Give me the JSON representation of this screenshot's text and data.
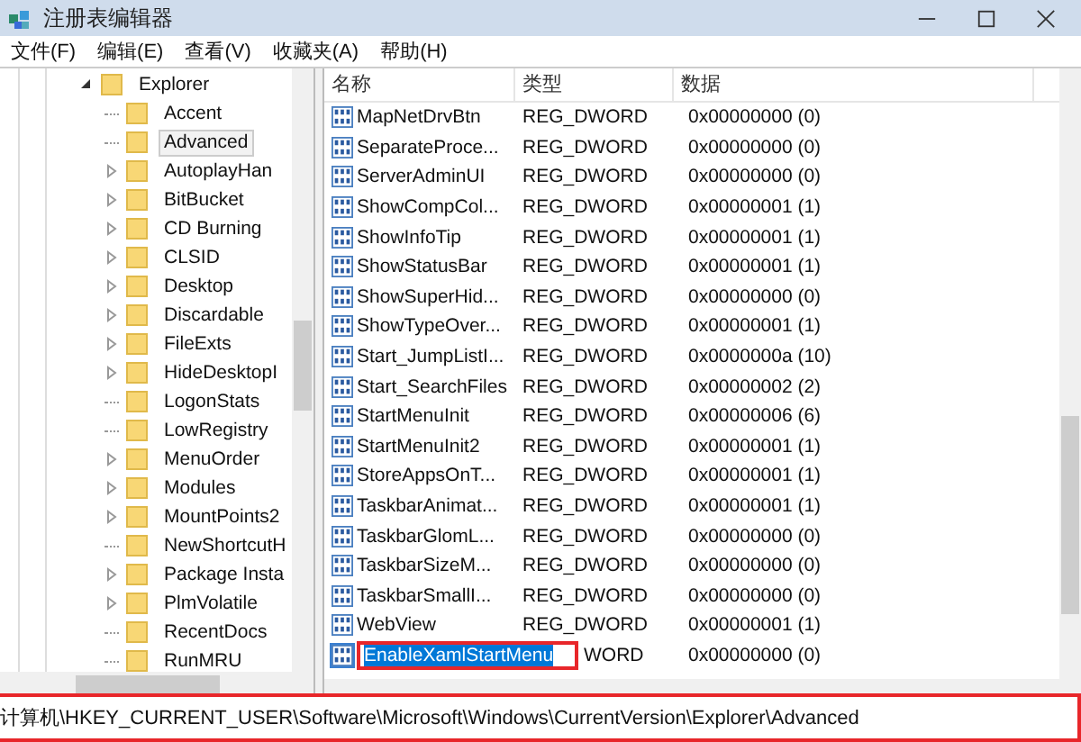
{
  "window": {
    "title": "注册表编辑器"
  },
  "menu": [
    "文件(F)",
    "编辑(E)",
    "查看(V)",
    "收藏夹(A)",
    "帮助(H)"
  ],
  "tree": {
    "label": "Explorer",
    "expanded": true,
    "children": [
      {
        "label": "Accent",
        "expandable": false,
        "selected": false
      },
      {
        "label": "Advanced",
        "expandable": false,
        "selected": true
      },
      {
        "label": "AutoplayHan",
        "expandable": true,
        "selected": false
      },
      {
        "label": "BitBucket",
        "expandable": true,
        "selected": false
      },
      {
        "label": "CD Burning",
        "expandable": true,
        "selected": false
      },
      {
        "label": "CLSID",
        "expandable": true,
        "selected": false
      },
      {
        "label": "Desktop",
        "expandable": true,
        "selected": false
      },
      {
        "label": "Discardable",
        "expandable": true,
        "selected": false
      },
      {
        "label": "FileExts",
        "expandable": true,
        "selected": false
      },
      {
        "label": "HideDesktopI",
        "expandable": true,
        "selected": false
      },
      {
        "label": "LogonStats",
        "expandable": false,
        "selected": false
      },
      {
        "label": "LowRegistry",
        "expandable": false,
        "selected": false
      },
      {
        "label": "MenuOrder",
        "expandable": true,
        "selected": false
      },
      {
        "label": "Modules",
        "expandable": true,
        "selected": false
      },
      {
        "label": "MountPoints2",
        "expandable": true,
        "selected": false
      },
      {
        "label": "NewShortcutH",
        "expandable": false,
        "selected": false
      },
      {
        "label": "Package Insta",
        "expandable": true,
        "selected": false
      },
      {
        "label": "PlmVolatile",
        "expandable": true,
        "selected": false
      },
      {
        "label": "RecentDocs",
        "expandable": false,
        "selected": false
      },
      {
        "label": "RunMRU",
        "expandable": false,
        "selected": false
      }
    ]
  },
  "table": {
    "columns": [
      "名称",
      "类型",
      "数据"
    ],
    "rows": [
      {
        "kind": "value",
        "name": "MapNetDrvBtn",
        "type": "REG_DWORD",
        "data": "0x00000000 (0)"
      },
      {
        "kind": "value",
        "name": "SeparateProce...",
        "type": "REG_DWORD",
        "data": "0x00000000 (0)"
      },
      {
        "kind": "value",
        "name": "ServerAdminUI",
        "type": "REG_DWORD",
        "data": "0x00000000 (0)"
      },
      {
        "kind": "value",
        "name": "ShowCompCol...",
        "type": "REG_DWORD",
        "data": "0x00000001 (1)"
      },
      {
        "kind": "value",
        "name": "ShowInfoTip",
        "type": "REG_DWORD",
        "data": "0x00000001 (1)"
      },
      {
        "kind": "value",
        "name": "ShowStatusBar",
        "type": "REG_DWORD",
        "data": "0x00000001 (1)"
      },
      {
        "kind": "value",
        "name": "ShowSuperHid...",
        "type": "REG_DWORD",
        "data": "0x00000000 (0)"
      },
      {
        "kind": "value",
        "name": "ShowTypeOver...",
        "type": "REG_DWORD",
        "data": "0x00000001 (1)"
      },
      {
        "kind": "value",
        "name": "Start_JumpListI...",
        "type": "REG_DWORD",
        "data": "0x0000000a (10)"
      },
      {
        "kind": "value",
        "name": "Start_SearchFiles",
        "type": "REG_DWORD",
        "data": "0x00000002 (2)"
      },
      {
        "kind": "value",
        "name": "StartMenuInit",
        "type": "REG_DWORD",
        "data": "0x00000006 (6)"
      },
      {
        "kind": "value",
        "name": "StartMenuInit2",
        "type": "REG_DWORD",
        "data": "0x00000001 (1)"
      },
      {
        "kind": "value",
        "name": "StoreAppsOnT...",
        "type": "REG_DWORD",
        "data": "0x00000001 (1)"
      },
      {
        "kind": "value",
        "name": "TaskbarAnimat...",
        "type": "REG_DWORD",
        "data": "0x00000001 (1)"
      },
      {
        "kind": "value",
        "name": "TaskbarGlomL...",
        "type": "REG_DWORD",
        "data": "0x00000000 (0)"
      },
      {
        "kind": "value",
        "name": "TaskbarSizeM...",
        "type": "REG_DWORD",
        "data": "0x00000000 (0)"
      },
      {
        "kind": "value",
        "name": "TaskbarSmallI...",
        "type": "REG_DWORD",
        "data": "0x00000000 (0)"
      },
      {
        "kind": "value",
        "name": "WebView",
        "type": "REG_DWORD",
        "data": "0x00000001 (1)"
      },
      {
        "kind": "editing",
        "name": "EnableXamlStartMenu",
        "type": "WORD",
        "data": "0x00000000 (0)"
      }
    ]
  },
  "status_bar": "计算机\\HKEY_CURRENT_USER\\Software\\Microsoft\\Windows\\CurrentVersion\\Explorer\\Advanced"
}
